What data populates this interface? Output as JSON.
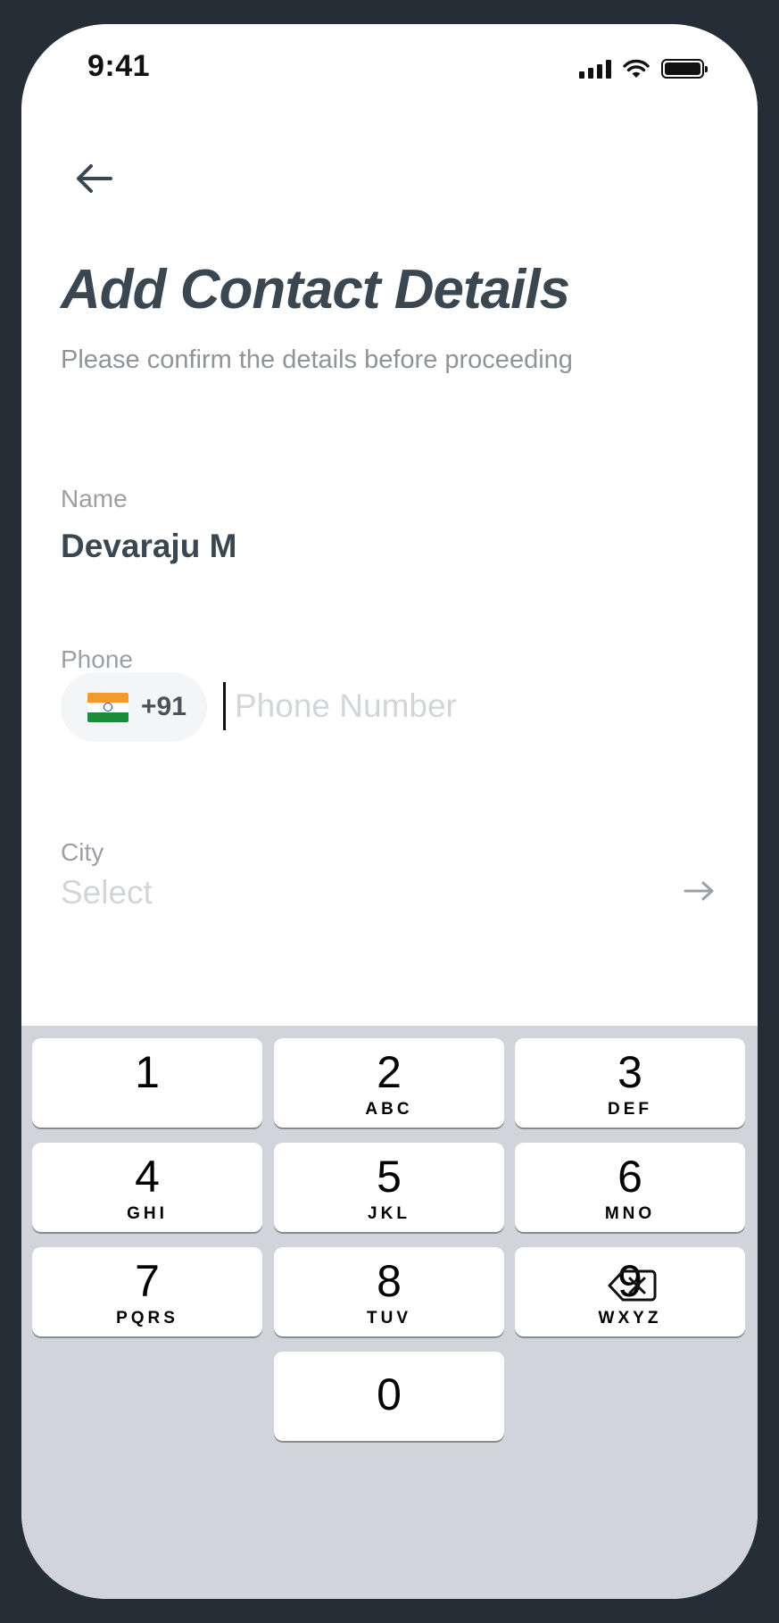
{
  "status_bar": {
    "time": "9:41"
  },
  "header": {
    "title": "Add Contact Details",
    "subtitle": "Please confirm the details before proceeding"
  },
  "form": {
    "name_label": "Name",
    "name_value": "Devaraju M",
    "phone_label": "Phone",
    "country_code": "+91",
    "country_flag": "india-flag-icon",
    "phone_value": "",
    "phone_placeholder": "Phone Number",
    "city_label": "City",
    "city_placeholder": "Select"
  },
  "keypad": {
    "keys": [
      {
        "digit": "1",
        "letters": ""
      },
      {
        "digit": "2",
        "letters": "ABC"
      },
      {
        "digit": "3",
        "letters": "DEF"
      },
      {
        "digit": "4",
        "letters": "GHI"
      },
      {
        "digit": "5",
        "letters": "JKL"
      },
      {
        "digit": "6",
        "letters": "MNO"
      },
      {
        "digit": "7",
        "letters": "PQRS"
      },
      {
        "digit": "8",
        "letters": "TUV"
      },
      {
        "digit": "9",
        "letters": "WXYZ"
      },
      {
        "digit": "0",
        "letters": ""
      }
    ],
    "delete_icon": "backspace-icon"
  },
  "colors": {
    "title": "#3a4650",
    "label": "#9aa0a5",
    "placeholder": "#d3d6d9",
    "keyboard_bg": "#d1d5db",
    "flag_saffron": "#f29a2b",
    "flag_green": "#1f8a3a"
  }
}
